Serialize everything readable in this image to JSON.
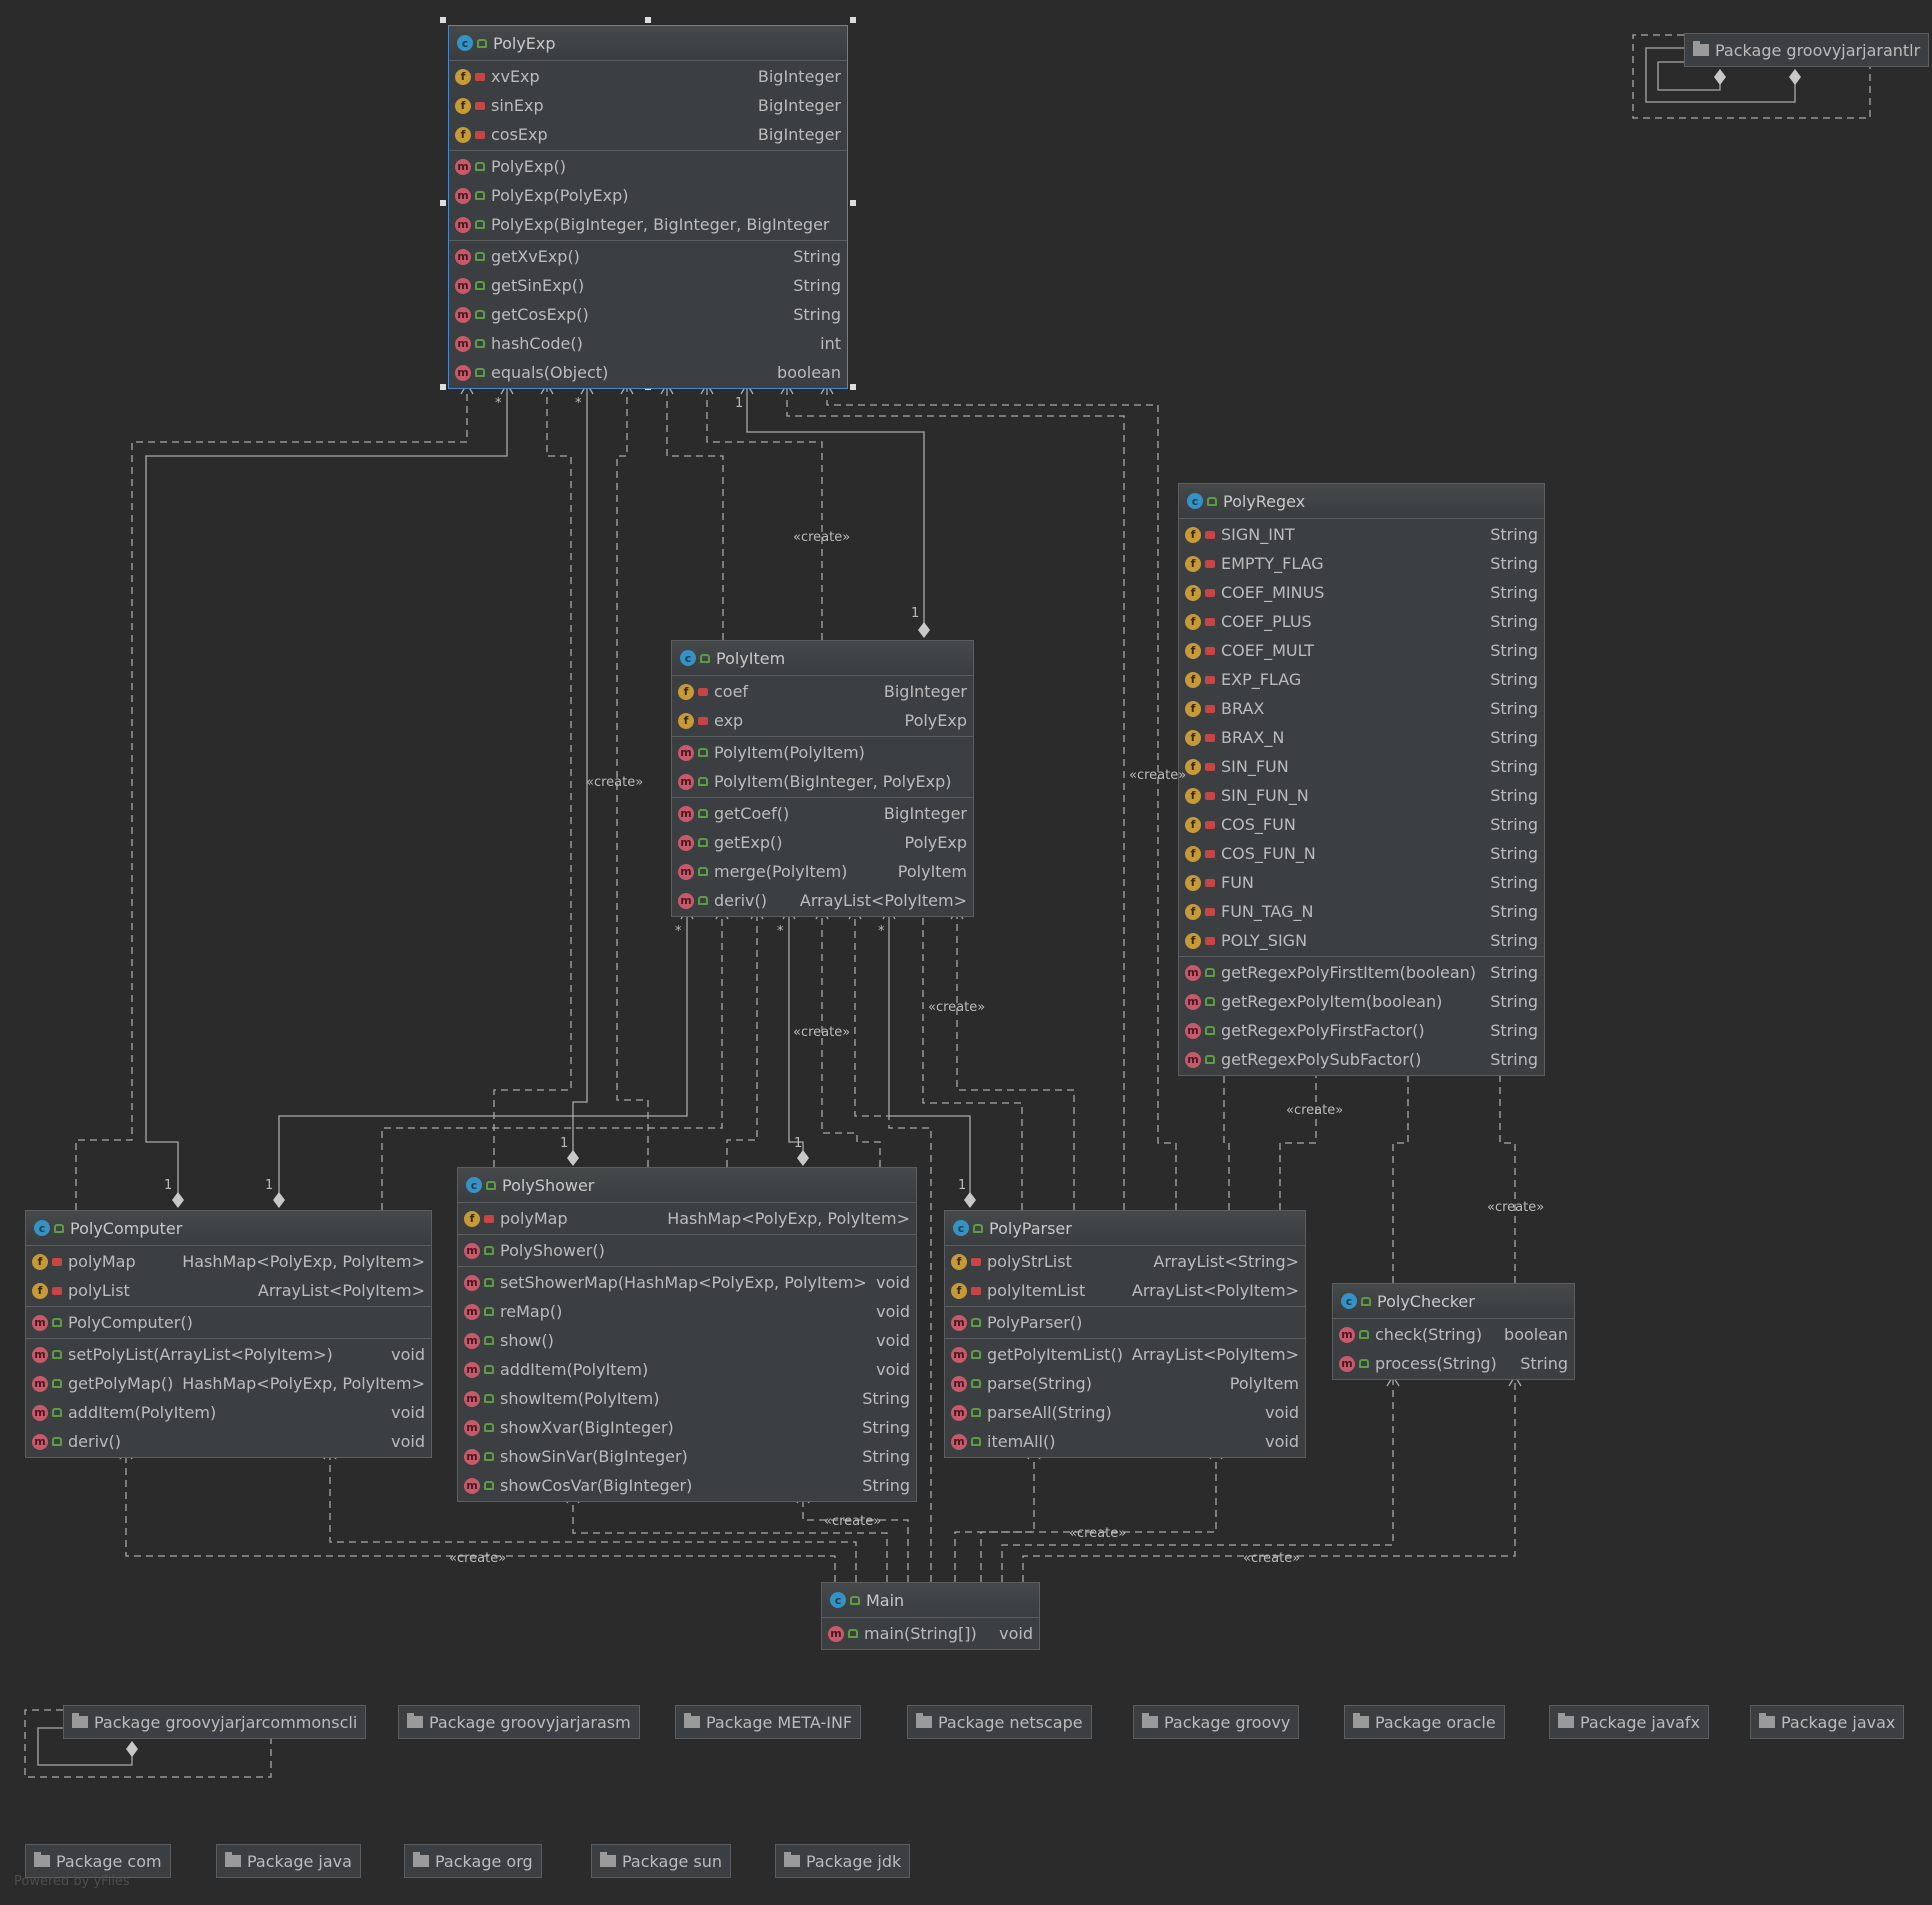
{
  "classes": {
    "polyexp": {
      "name": "PolyExp",
      "fields": [
        {
          "name": "xvExp",
          "type": "BigInteger"
        },
        {
          "name": "sinExp",
          "type": "BigInteger"
        },
        {
          "name": "cosExp",
          "type": "BigInteger"
        }
      ],
      "constructors": [
        {
          "name": "PolyExp()",
          "type": ""
        },
        {
          "name": "PolyExp(PolyExp)",
          "type": ""
        },
        {
          "name": "PolyExp(BigInteger, BigInteger, BigInteger)",
          "type": ""
        }
      ],
      "methods": [
        {
          "name": "getXvExp()",
          "type": "String"
        },
        {
          "name": "getSinExp()",
          "type": "String"
        },
        {
          "name": "getCosExp()",
          "type": "String"
        },
        {
          "name": "hashCode()",
          "type": "int"
        },
        {
          "name": "equals(Object)",
          "type": "boolean"
        }
      ]
    },
    "polyregex": {
      "name": "PolyRegex",
      "fields": [
        {
          "name": "SIGN_INT",
          "type": "String"
        },
        {
          "name": "EMPTY_FLAG",
          "type": "String"
        },
        {
          "name": "COEF_MINUS",
          "type": "String"
        },
        {
          "name": "COEF_PLUS",
          "type": "String"
        },
        {
          "name": "COEF_MULT",
          "type": "String"
        },
        {
          "name": "EXP_FLAG",
          "type": "String"
        },
        {
          "name": "BRAX",
          "type": "String"
        },
        {
          "name": "BRAX_N",
          "type": "String"
        },
        {
          "name": "SIN_FUN",
          "type": "String"
        },
        {
          "name": "SIN_FUN_N",
          "type": "String"
        },
        {
          "name": "COS_FUN",
          "type": "String"
        },
        {
          "name": "COS_FUN_N",
          "type": "String"
        },
        {
          "name": "FUN",
          "type": "String"
        },
        {
          "name": "FUN_TAG_N",
          "type": "String"
        },
        {
          "name": "POLY_SIGN",
          "type": "String"
        }
      ],
      "methods": [
        {
          "name": "getRegexPolyFirstItem(boolean)",
          "type": "String"
        },
        {
          "name": "getRegexPolyItem(boolean)",
          "type": "String"
        },
        {
          "name": "getRegexPolyFirstFactor()",
          "type": "String"
        },
        {
          "name": "getRegexPolySubFactor()",
          "type": "String"
        }
      ]
    },
    "polyitem": {
      "name": "PolyItem",
      "fields": [
        {
          "name": "coef",
          "type": "BigInteger"
        },
        {
          "name": "exp",
          "type": "PolyExp"
        }
      ],
      "constructors": [
        {
          "name": "PolyItem(PolyItem)",
          "type": ""
        },
        {
          "name": "PolyItem(BigInteger, PolyExp)",
          "type": ""
        }
      ],
      "methods": [
        {
          "name": "getCoef()",
          "type": "BigInteger"
        },
        {
          "name": "getExp()",
          "type": "PolyExp"
        },
        {
          "name": "merge(PolyItem)",
          "type": "PolyItem"
        },
        {
          "name": "deriv()",
          "type": "ArrayList<PolyItem>"
        }
      ]
    },
    "polycomputer": {
      "name": "PolyComputer",
      "fields": [
        {
          "name": "polyMap",
          "type": "HashMap<PolyExp, PolyItem>"
        },
        {
          "name": "polyList",
          "type": "ArrayList<PolyItem>"
        }
      ],
      "constructors": [
        {
          "name": "PolyComputer()",
          "type": ""
        }
      ],
      "methods": [
        {
          "name": "setPolyList(ArrayList<PolyItem>)",
          "type": "void"
        },
        {
          "name": "getPolyMap()",
          "type": "HashMap<PolyExp, PolyItem>"
        },
        {
          "name": "addItem(PolyItem)",
          "type": "void"
        },
        {
          "name": "deriv()",
          "type": "void"
        }
      ]
    },
    "polyshower": {
      "name": "PolyShower",
      "fields": [
        {
          "name": "polyMap",
          "type": "HashMap<PolyExp, PolyItem>"
        }
      ],
      "constructors": [
        {
          "name": "PolyShower()",
          "type": ""
        }
      ],
      "methods": [
        {
          "name": "setShowerMap(HashMap<PolyExp, PolyItem>)",
          "type": "void"
        },
        {
          "name": "reMap()",
          "type": "void"
        },
        {
          "name": "show()",
          "type": "void"
        },
        {
          "name": "addItem(PolyItem)",
          "type": "void"
        },
        {
          "name": "showItem(PolyItem)",
          "type": "String"
        },
        {
          "name": "showXvar(BigInteger)",
          "type": "String"
        },
        {
          "name": "showSinVar(BigInteger)",
          "type": "String"
        },
        {
          "name": "showCosVar(BigInteger)",
          "type": "String"
        }
      ]
    },
    "polyparser": {
      "name": "PolyParser",
      "fields": [
        {
          "name": "polyStrList",
          "type": "ArrayList<String>"
        },
        {
          "name": "polyItemList",
          "type": "ArrayList<PolyItem>"
        }
      ],
      "constructors": [
        {
          "name": "PolyParser()",
          "type": ""
        }
      ],
      "methods": [
        {
          "name": "getPolyItemList()",
          "type": "ArrayList<PolyItem>"
        },
        {
          "name": "parse(String)",
          "type": "PolyItem"
        },
        {
          "name": "parseAll(String)",
          "type": "void"
        },
        {
          "name": "itemAll()",
          "type": "void"
        }
      ]
    },
    "polychecker": {
      "name": "PolyChecker",
      "methods": [
        {
          "name": "check(String)",
          "type": "boolean"
        },
        {
          "name": "process(String)",
          "type": "String"
        }
      ]
    },
    "main": {
      "name": "Main",
      "methods": [
        {
          "name": "main(String[])",
          "type": "void"
        }
      ]
    }
  },
  "packages": [
    "Package groovyjarjarantlr",
    "Package groovyjarjarcommonscli",
    "Package groovyjarjarasm",
    "Package META-INF",
    "Package netscape",
    "Package groovy",
    "Package oracle",
    "Package javafx",
    "Package javax",
    "Package com",
    "Package java",
    "Package org",
    "Package sun",
    "Package jdk"
  ],
  "edge_labels": {
    "create": "«create»",
    "one": "1",
    "many": "*"
  },
  "footer": "Powered by yFiles"
}
